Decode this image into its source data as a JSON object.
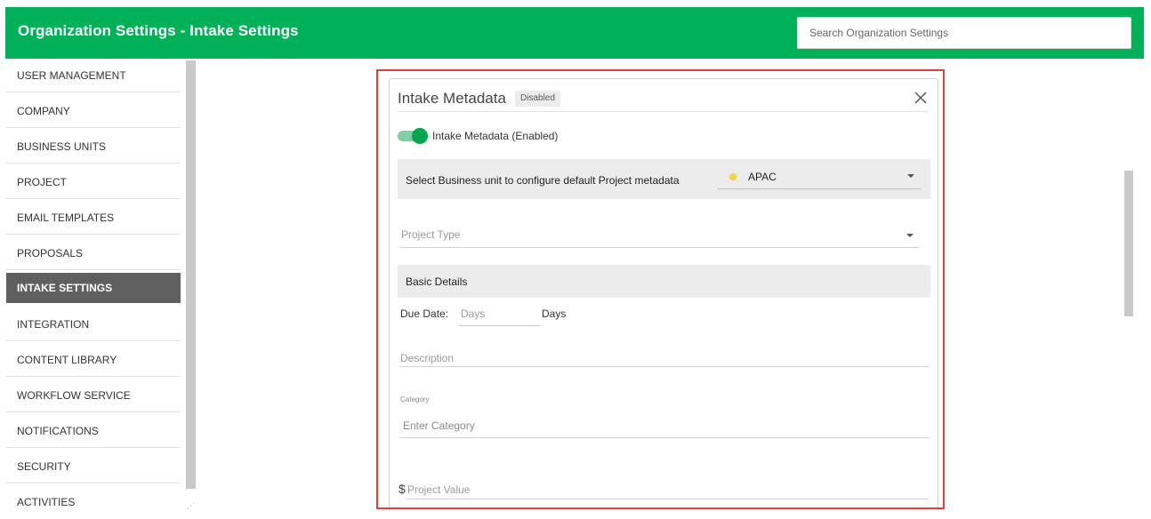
{
  "header": {
    "title": "Organization Settings - Intake Settings",
    "search_placeholder": "Search Organization Settings",
    "color": "#00b15a"
  },
  "sidebar": {
    "items": [
      {
        "label": "USER MANAGEMENT",
        "active": false
      },
      {
        "label": "COMPANY",
        "active": false
      },
      {
        "label": "BUSINESS UNITS",
        "active": false
      },
      {
        "label": "PROJECT",
        "active": false
      },
      {
        "label": "EMAIL TEMPLATES",
        "active": false
      },
      {
        "label": "PROPOSALS",
        "active": false
      },
      {
        "label": "INTAKE SETTINGS",
        "active": true
      },
      {
        "label": "INTEGRATION",
        "active": false
      },
      {
        "label": "CONTENT LIBRARY",
        "active": false
      },
      {
        "label": "WORKFLOW SERVICE",
        "active": false
      },
      {
        "label": "NOTIFICATIONS",
        "active": false
      },
      {
        "label": "SECURITY",
        "active": false
      },
      {
        "label": "ACTIVITIES",
        "active": false
      }
    ]
  },
  "panel": {
    "title": "Intake Metadata",
    "badge": "Disabled",
    "close_icon": "close-icon",
    "toggle": {
      "label": "Intake Metadata (Enabled)",
      "on": true
    },
    "business_unit": {
      "label": "Select Business unit to configure default Project metadata",
      "value": "APAC",
      "dot_color": "#f5d33a"
    },
    "project_type": {
      "placeholder": "Project Type"
    },
    "basic_details": {
      "title": "Basic Details"
    },
    "due_date": {
      "label": "Due Date:",
      "placeholder": "Days",
      "unit": "Days"
    },
    "description": {
      "placeholder": "Description"
    },
    "category": {
      "label": "Category",
      "placeholder": "Enter Category"
    },
    "project_value": {
      "currency": "$",
      "placeholder": "Project Value"
    }
  },
  "highlight_color": "#e0403d"
}
